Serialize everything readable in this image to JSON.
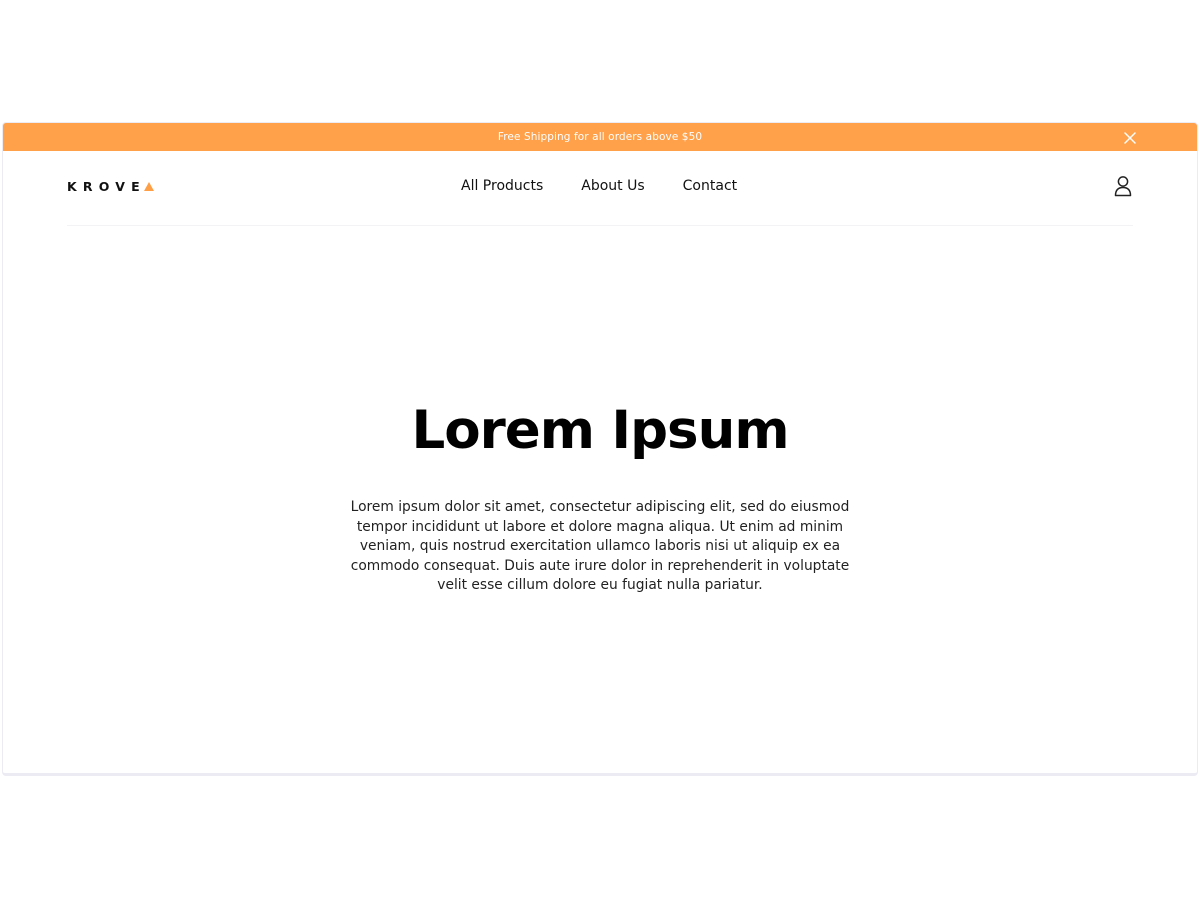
{
  "announcement": {
    "text": "Free Shipping for all orders above $50",
    "close_icon": "close-icon",
    "background": "#ffa04a"
  },
  "header": {
    "logo_text": "KROVE",
    "logo_mark_icon": "triangle-icon",
    "logo_mark_color": "#ff9f45",
    "nav": [
      {
        "label": "All Products"
      },
      {
        "label": "About Us"
      },
      {
        "label": "Contact"
      }
    ],
    "account_icon": "user-icon"
  },
  "hero": {
    "title": "Lorem Ipsum",
    "body": "Lorem ipsum dolor sit amet, consectetur adipiscing elit, sed do eiusmod tempor incididunt ut labore et dolore magna aliqua. Ut enim ad minim veniam, quis nostrud exercitation ullamco laboris nisi ut aliquip ex ea commodo consequat. Duis aute irure dolor in reprehenderit in voluptate velit esse cillum dolore eu fugiat nulla pariatur."
  }
}
